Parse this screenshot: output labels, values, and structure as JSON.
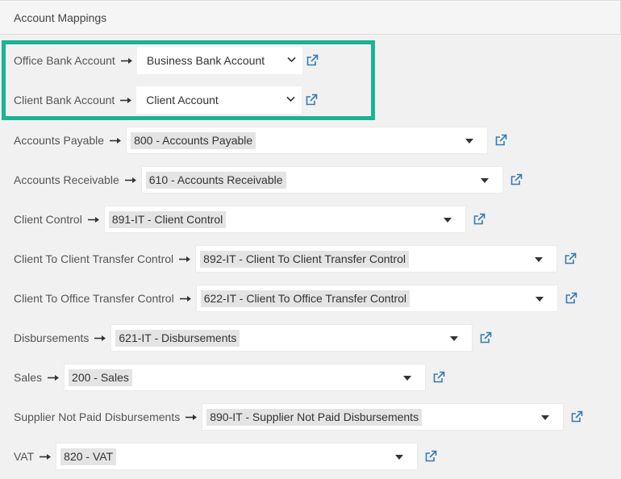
{
  "header": {
    "title": "Account Mappings"
  },
  "icons": {
    "arrow": "right-arrow-icon",
    "external": "external-link-icon",
    "dropdown": "caret-down-icon"
  },
  "colors": {
    "highlight": "#1ab394",
    "link": "#337ab7"
  },
  "mappings": [
    {
      "label": "Office Bank Account",
      "value": "Business Bank Account"
    },
    {
      "label": "Client Bank Account",
      "value": "Client Account"
    },
    {
      "label": "Accounts Payable",
      "value": "800 - Accounts Payable"
    },
    {
      "label": "Accounts Receivable",
      "value": "610 - Accounts Receivable"
    },
    {
      "label": "Client Control",
      "value": "891-IT - Client Control"
    },
    {
      "label": "Client To Client Transfer Control",
      "value": "892-IT - Client To Client Transfer Control"
    },
    {
      "label": "Client To Office Transfer Control",
      "value": "622-IT - Client To Office Transfer Control"
    },
    {
      "label": "Disbursements",
      "value": "621-IT - Disbursements"
    },
    {
      "label": "Sales",
      "value": "200 - Sales"
    },
    {
      "label": "Supplier Not Paid Disbursements",
      "value": "890-IT - Supplier Not Paid Disbursements"
    },
    {
      "label": "VAT",
      "value": "820 - VAT"
    }
  ]
}
